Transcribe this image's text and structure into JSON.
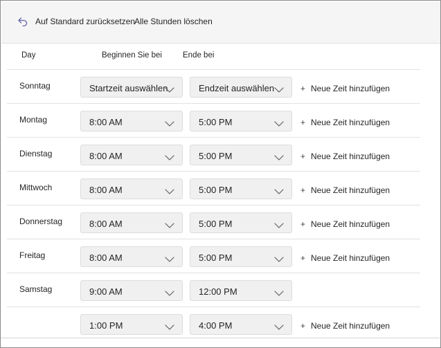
{
  "toolbar": {
    "reset_label": "Auf Standard zurücksetzen",
    "clear_label": "Alle Stunden löschen"
  },
  "columns": {
    "day": "Day",
    "start": "Beginnen Sie bei",
    "end": "Ende bei"
  },
  "add_label": "Neue Zeit hinzufügen",
  "rows": [
    {
      "day": "Sonntag",
      "start": "Startzeit auswählen",
      "end": "Endzeit auswählen"
    },
    {
      "day": "Montag",
      "start": "8:00 AM",
      "end": "5:00 PM"
    },
    {
      "day": "Dienstag",
      "start": "8:00 AM",
      "end": "5:00 PM"
    },
    {
      "day": "Mittwoch",
      "start": "8:00 AM",
      "end": "5:00 PM"
    },
    {
      "day": "Donnerstag",
      "start": "8:00 AM",
      "end": "5:00 PM"
    },
    {
      "day": "Freitag",
      "start": "8:00 AM",
      "end": "5:00 PM"
    },
    {
      "day": "Samstag",
      "start": "9:00 AM",
      "end": "12:00 PM"
    },
    {
      "day": "",
      "start": "1:00 PM",
      "end": "4:00 PM"
    }
  ]
}
